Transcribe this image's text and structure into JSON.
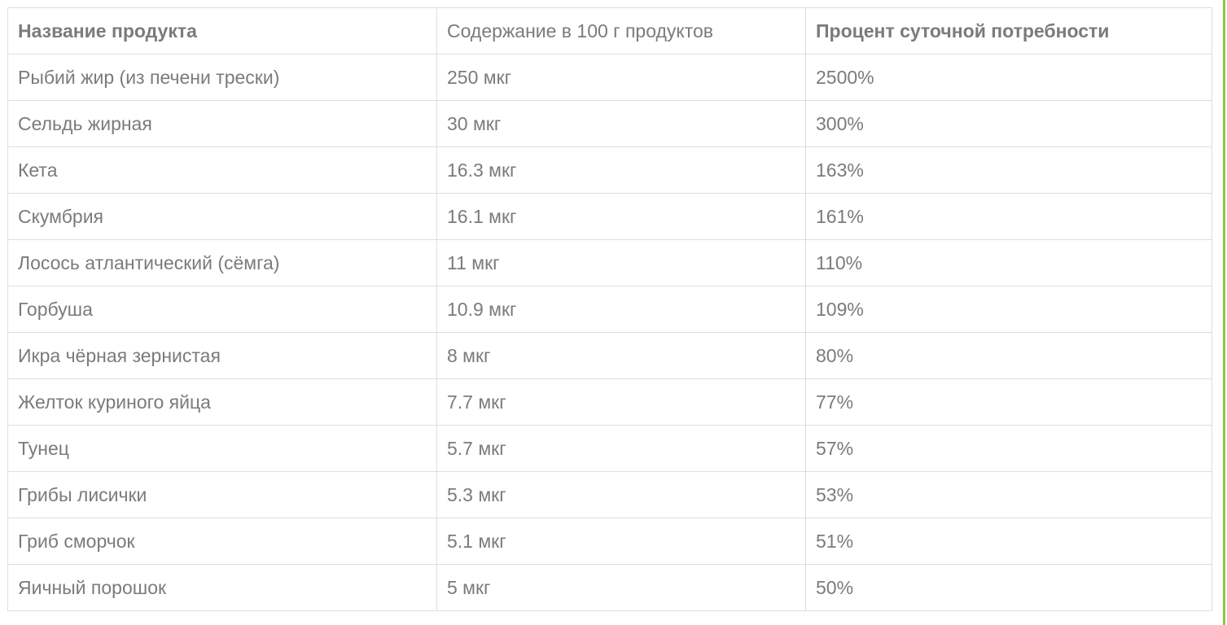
{
  "accent_color": "#8cc63f",
  "table": {
    "headers": [
      "Название продукта",
      "Содержание в 100 г продуктов",
      "Процент суточной потребности"
    ],
    "rows": [
      [
        "Рыбий жир (из печени трески)",
        "250 мкг",
        "2500%"
      ],
      [
        "Сельдь жирная",
        "30 мкг",
        "300%"
      ],
      [
        "Кета",
        "16.3 мкг",
        "163%"
      ],
      [
        "Скумбрия",
        "16.1 мкг",
        "161%"
      ],
      [
        "Лосось атлантический (сёмга)",
        "11 мкг",
        "110%"
      ],
      [
        "Горбуша",
        "10.9 мкг",
        "109%"
      ],
      [
        "Икра чёрная зернистая",
        "8 мкг",
        "80%"
      ],
      [
        "Желток куриного яйца",
        "7.7 мкг",
        "77%"
      ],
      [
        "Тунец",
        "5.7 мкг",
        "57%"
      ],
      [
        "Грибы лисички",
        "5.3 мкг",
        "53%"
      ],
      [
        "Гриб сморчок",
        "5.1 мкг",
        "51%"
      ],
      [
        "Яичный порошок",
        "5 мкг",
        "50%"
      ]
    ]
  }
}
